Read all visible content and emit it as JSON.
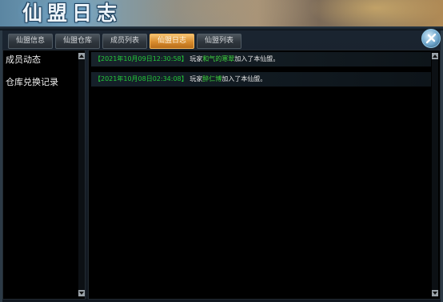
{
  "window": {
    "title": "仙盟日志"
  },
  "tabs": [
    {
      "label": "仙盟信息"
    },
    {
      "label": "仙盟仓库"
    },
    {
      "label": "成员列表"
    },
    {
      "label": "仙盟日志"
    },
    {
      "label": "仙盟列表"
    }
  ],
  "active_tab": "仙盟日志",
  "sidebar": {
    "items": [
      {
        "label": "成员动态"
      },
      {
        "label": "仓库兑换记录"
      }
    ]
  },
  "log": {
    "entries": [
      {
        "timestamp": "【2021年10月09日12:30:58】",
        "prefix": "玩家",
        "player": "和气的寒翠",
        "suffix": "加入了本仙盟。"
      },
      {
        "timestamp": "【2021年10月08日02:34:08】",
        "prefix": "玩家",
        "player": "醉仁博",
        "suffix": "加入了本仙盟。"
      }
    ]
  },
  "colors": {
    "timestamp": "#23c93a",
    "player_name": "#3ed83e",
    "active_tab": "#e39a3a"
  },
  "icons": {
    "close": "close-icon"
  }
}
